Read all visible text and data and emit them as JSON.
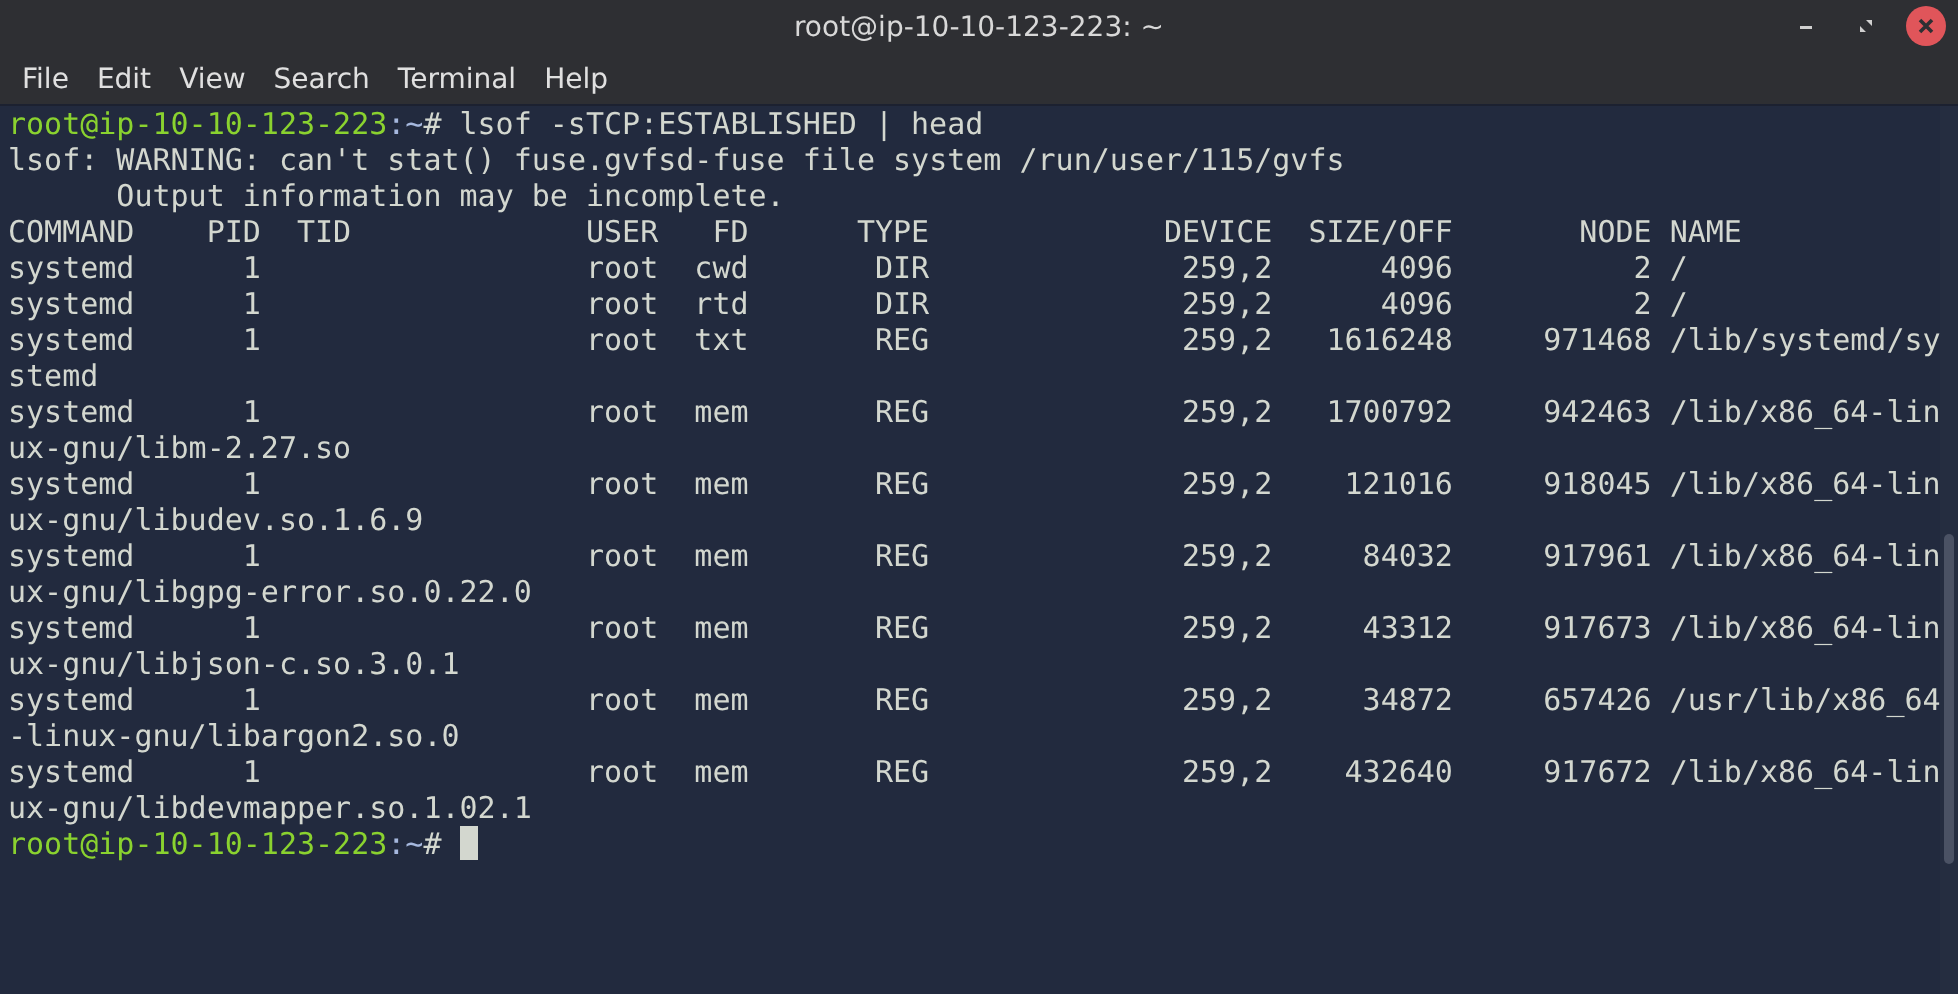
{
  "window": {
    "title": "root@ip-10-10-123-223: ~"
  },
  "menu": [
    "File",
    "Edit",
    "View",
    "Search",
    "Terminal",
    "Help"
  ],
  "terminal": {
    "lines": [
      {
        "kind": "prompt",
        "user_host": "root@ip-10-10-123-223",
        "path": ":~",
        "symbol": "#",
        "command": "lsof -sTCP:ESTABLISHED | head"
      },
      {
        "kind": "output",
        "text": "lsof: WARNING: can't stat() fuse.gvfsd-fuse file system /run/user/115/gvfs"
      },
      {
        "kind": "output",
        "text": "      Output information may be incomplete."
      },
      {
        "kind": "output",
        "text": "COMMAND    PID  TID             USER   FD      TYPE             DEVICE  SIZE/OFF       NODE NAME"
      },
      {
        "kind": "output",
        "text": "systemd      1                  root  cwd       DIR              259,2      4096          2 /"
      },
      {
        "kind": "output",
        "text": "systemd      1                  root  rtd       DIR              259,2      4096          2 /"
      },
      {
        "kind": "output",
        "text": "systemd      1                  root  txt       REG              259,2   1616248     971468 /lib/systemd/sy"
      },
      {
        "kind": "output",
        "text": "stemd"
      },
      {
        "kind": "output",
        "text": "systemd      1                  root  mem       REG              259,2   1700792     942463 /lib/x86_64-lin"
      },
      {
        "kind": "output",
        "text": "ux-gnu/libm-2.27.so"
      },
      {
        "kind": "output",
        "text": "systemd      1                  root  mem       REG              259,2    121016     918045 /lib/x86_64-lin"
      },
      {
        "kind": "output",
        "text": "ux-gnu/libudev.so.1.6.9"
      },
      {
        "kind": "output",
        "text": "systemd      1                  root  mem       REG              259,2     84032     917961 /lib/x86_64-lin"
      },
      {
        "kind": "output",
        "text": "ux-gnu/libgpg-error.so.0.22.0"
      },
      {
        "kind": "output",
        "text": "systemd      1                  root  mem       REG              259,2     43312     917673 /lib/x86_64-lin"
      },
      {
        "kind": "output",
        "text": "ux-gnu/libjson-c.so.3.0.1"
      },
      {
        "kind": "output",
        "text": "systemd      1                  root  mem       REG              259,2     34872     657426 /usr/lib/x86_64"
      },
      {
        "kind": "output",
        "text": "-linux-gnu/libargon2.so.0"
      },
      {
        "kind": "output",
        "text": "systemd      1                  root  mem       REG              259,2    432640     917672 /lib/x86_64-lin"
      },
      {
        "kind": "output",
        "text": "ux-gnu/libdevmapper.so.1.02.1"
      },
      {
        "kind": "prompt",
        "user_host": "root@ip-10-10-123-223",
        "path": ":~",
        "symbol": "#",
        "cursor": true
      }
    ]
  }
}
